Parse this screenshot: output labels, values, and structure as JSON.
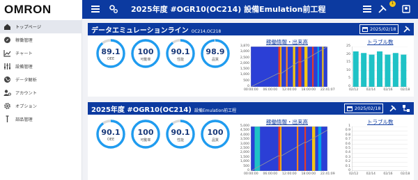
{
  "topbar": {
    "brand": "OMRON",
    "page_title": "2025年度 #OGR10(OC214) 設備Emulation前工程",
    "notification_count": "1"
  },
  "sidebar": {
    "items": [
      {
        "label": "トップページ",
        "icon": "home-icon",
        "active": true
      },
      {
        "label": "稼働管理",
        "icon": "compass-icon",
        "active": false
      },
      {
        "label": "チャート",
        "icon": "chart-icon",
        "active": false
      },
      {
        "label": "設備管理",
        "icon": "sliders-icon",
        "active": false
      },
      {
        "label": "データ解析",
        "icon": "globe-icon",
        "active": false
      },
      {
        "label": "アカウント",
        "icon": "account-icon",
        "active": false
      },
      {
        "label": "オプション",
        "icon": "gear-icon",
        "active": false
      },
      {
        "label": "部品管理",
        "icon": "pin-icon",
        "active": false
      }
    ]
  },
  "panels": [
    {
      "title": "データエミュレーションライン",
      "subtitle": "OC214,OC218",
      "date": "2025/02/18",
      "gauges": [
        {
          "value": "89.1",
          "label": "OEE",
          "fraction": 0.891
        },
        {
          "value": "100",
          "label": "可動率",
          "fraction": 1.0
        },
        {
          "value": "90.1",
          "label": "性能",
          "fraction": 0.901
        },
        {
          "value": "98.9",
          "label": "品質",
          "fraction": 0.989
        }
      ],
      "operation_chart_title": "稼働情報・出来高",
      "trouble_chart_title": "トラブル数"
    },
    {
      "title": "2025年度 #OGR10(OC214)",
      "subtitle": "設備Emulation前工程",
      "date": "2025/02/18",
      "gauges": [
        {
          "value": "90.1",
          "label": "OEE",
          "fraction": 0.901
        },
        {
          "value": "100",
          "label": "可動率",
          "fraction": 1.0
        },
        {
          "value": "90.1",
          "label": "性能",
          "fraction": 0.901
        },
        {
          "value": "100",
          "label": "品質",
          "fraction": 1.0
        }
      ],
      "operation_chart_title": "稼働情報・出来高",
      "trouble_chart_title": "トラブル数"
    }
  ],
  "chart_data": [
    {
      "type": "bar",
      "title": "稼働情報・出来高",
      "x_ticks": [
        "00:00:00",
        "06:00:00",
        "12:00:00",
        "18:00:00",
        "22:41:07"
      ],
      "y_ticks": [
        "0",
        "500",
        "1,000",
        "1,500",
        "2,000",
        "2,500",
        "3,000",
        "3,870"
      ],
      "ylim": [
        0,
        3870
      ],
      "segments": [
        {
          "start": 0.0,
          "end": 0.36,
          "color": "#2b3fd6"
        },
        {
          "start": 0.36,
          "end": 0.385,
          "color": "#e23b2a"
        },
        {
          "start": 0.385,
          "end": 0.4,
          "color": "#f2c417"
        },
        {
          "start": 0.4,
          "end": 0.46,
          "color": "#2b3fd6"
        },
        {
          "start": 0.46,
          "end": 0.48,
          "color": "#ff7f1e"
        },
        {
          "start": 0.48,
          "end": 0.55,
          "color": "#2b3fd6"
        },
        {
          "start": 0.55,
          "end": 0.58,
          "color": "#f2c417"
        },
        {
          "start": 0.58,
          "end": 0.62,
          "color": "#2b3fd6"
        },
        {
          "start": 0.62,
          "end": 0.66,
          "color": "#e23b2a"
        },
        {
          "start": 0.66,
          "end": 0.7,
          "color": "#2b3fd6"
        },
        {
          "start": 0.7,
          "end": 0.74,
          "color": "#f2c417"
        },
        {
          "start": 0.74,
          "end": 0.8,
          "color": "#2b3fd6"
        },
        {
          "start": 0.8,
          "end": 0.82,
          "color": "#e23b2a"
        },
        {
          "start": 0.82,
          "end": 0.87,
          "color": "#2b3fd6"
        },
        {
          "start": 0.87,
          "end": 0.89,
          "color": "#00a2e8"
        },
        {
          "start": 0.89,
          "end": 0.93,
          "color": "#2b3fd6"
        },
        {
          "start": 0.93,
          "end": 0.95,
          "color": "#f2c417"
        },
        {
          "start": 0.95,
          "end": 1.0,
          "color": "#2b3fd6"
        }
      ],
      "output_line": [
        {
          "x": 0.0,
          "y": 0
        },
        {
          "x": 0.36,
          "y": 1300
        },
        {
          "x": 0.4,
          "y": 1300
        },
        {
          "x": 0.62,
          "y": 2400
        },
        {
          "x": 0.66,
          "y": 2400
        },
        {
          "x": 1.0,
          "y": 3870
        }
      ]
    },
    {
      "type": "bar",
      "title": "トラブル数",
      "categories": [
        "02/12",
        "02/13",
        "02/14",
        "02/15",
        "02/16",
        "02/17",
        "02/18"
      ],
      "x_ticks": [
        "02/12",
        "02/14",
        "02/16",
        "02/18"
      ],
      "y_ticks": [
        "0",
        "5",
        "10",
        "15",
        "20",
        "25"
      ],
      "values": [
        22,
        21,
        20,
        22,
        20,
        21,
        20
      ],
      "ylim": [
        0,
        25
      ],
      "color": "#1fc2c6"
    },
    {
      "type": "bar",
      "title": "稼働情報・出来高",
      "x_ticks": [
        "00:00:00",
        "06:00:00",
        "12:00:00",
        "18:00:00",
        "22:41:09"
      ],
      "y_ticks": [
        "0",
        "500",
        "1,000",
        "1,500",
        "2,000",
        "2,500",
        "3,000",
        "3,500",
        "4,000",
        "4,500",
        "5,000"
      ],
      "ylim": [
        0,
        5000
      ],
      "segments": [
        {
          "start": 0.0,
          "end": 0.05,
          "color": "#2b3fd6"
        },
        {
          "start": 0.05,
          "end": 0.12,
          "color": "#1fc2c6"
        },
        {
          "start": 0.12,
          "end": 0.36,
          "color": "#2b3fd6"
        },
        {
          "start": 0.36,
          "end": 0.385,
          "color": "#e23b2a"
        },
        {
          "start": 0.385,
          "end": 0.4,
          "color": "#f2c417"
        },
        {
          "start": 0.4,
          "end": 0.6,
          "color": "#2b3fd6"
        },
        {
          "start": 0.6,
          "end": 0.62,
          "color": "#ff7f1e"
        },
        {
          "start": 0.62,
          "end": 0.7,
          "color": "#2b3fd6"
        },
        {
          "start": 0.7,
          "end": 0.72,
          "color": "#e23b2a"
        },
        {
          "start": 0.72,
          "end": 0.8,
          "color": "#2b3fd6"
        },
        {
          "start": 0.8,
          "end": 0.84,
          "color": "#f2c417"
        },
        {
          "start": 0.84,
          "end": 0.88,
          "color": "#2b3fd6"
        },
        {
          "start": 0.88,
          "end": 0.92,
          "color": "#00a2e8"
        },
        {
          "start": 0.92,
          "end": 1.0,
          "color": "#2b3fd6"
        }
      ],
      "output_line": [
        {
          "x": 0.0,
          "y": 0
        },
        {
          "x": 0.36,
          "y": 1700
        },
        {
          "x": 0.4,
          "y": 1700
        },
        {
          "x": 0.7,
          "y": 3200
        },
        {
          "x": 0.72,
          "y": 3200
        },
        {
          "x": 1.0,
          "y": 4600
        }
      ]
    },
    {
      "type": "bar",
      "title": "トラブル数",
      "categories": [],
      "x_ticks": [
        "02/12",
        "02/14",
        "02/16",
        "02/18"
      ],
      "y_ticks": [
        "0",
        "0.1",
        "0.2",
        "0.3",
        "0.4",
        "0.5",
        "0.6",
        "0.7",
        "0.8",
        "0.9",
        "1"
      ],
      "values": [],
      "ylim": [
        0,
        1
      ]
    }
  ],
  "colors": {
    "primary": "#0c3aa0",
    "gauge": "#1f9cf0",
    "gauge_track": "#d9d9d9",
    "sidebar_active": "#e4e7ee",
    "trouble_bar": "#1fc2c6"
  }
}
